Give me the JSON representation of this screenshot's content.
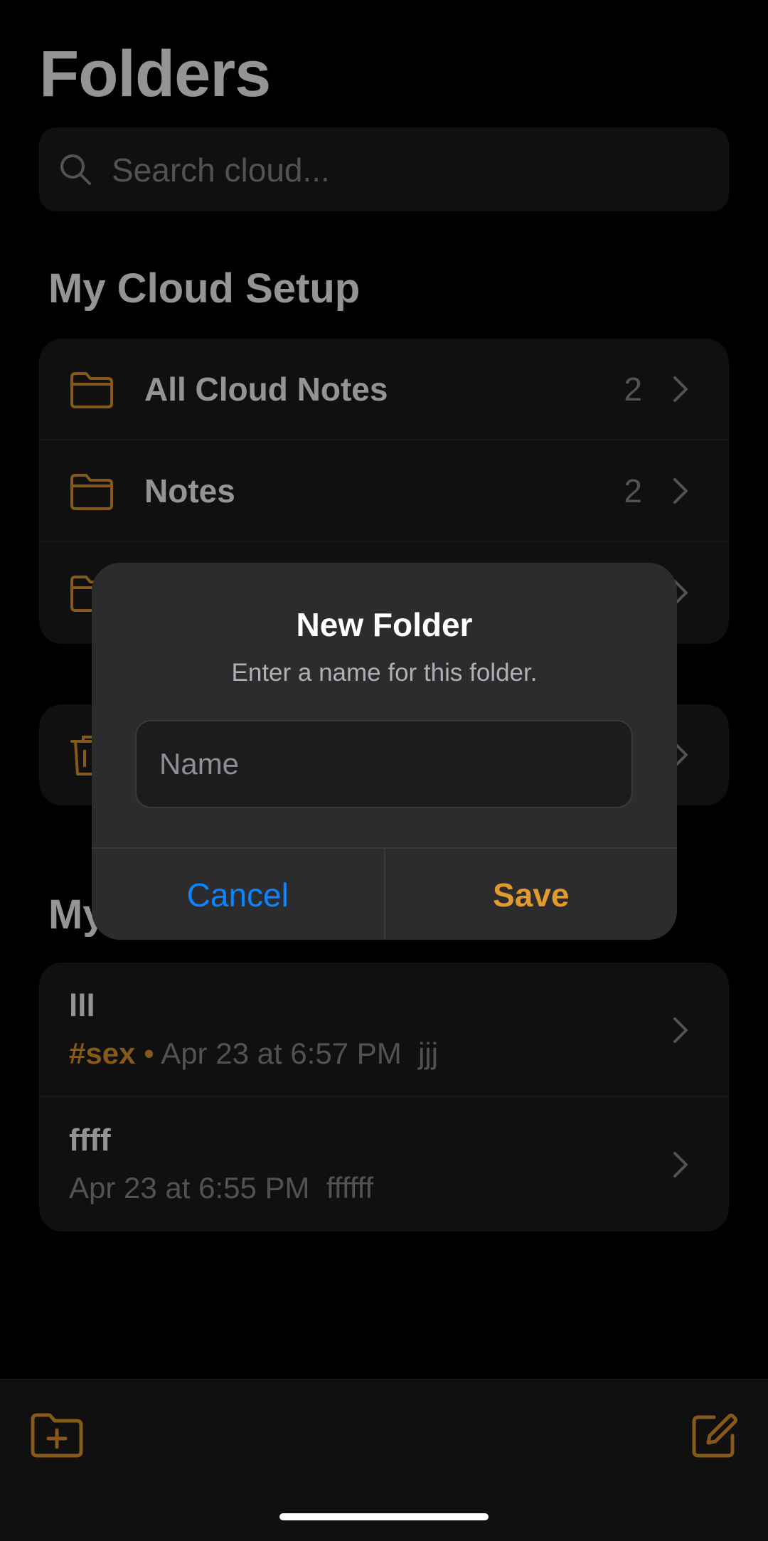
{
  "header": {
    "title": "Folders"
  },
  "search": {
    "placeholder": "Search cloud..."
  },
  "cloud_section": {
    "title": "My Cloud Setup",
    "folders": [
      {
        "label": "All Cloud Notes",
        "count": "2"
      },
      {
        "label": "Notes",
        "count": "2"
      },
      {
        "label": "",
        "count": ""
      }
    ]
  },
  "notes_section": {
    "title": "My",
    "notes": [
      {
        "title": "lll",
        "tag": "#sex",
        "separator": "•",
        "date": "Apr 23 at 6:57 PM",
        "preview": "jjj"
      },
      {
        "title": "ffff",
        "tag": "",
        "separator": "",
        "date": "Apr 23 at 6:55 PM",
        "preview": "ffffff"
      }
    ]
  },
  "dialog": {
    "title": "New Folder",
    "message": "Enter a name for this folder.",
    "input_placeholder": "Name",
    "input_value": "",
    "cancel_label": "Cancel",
    "save_label": "Save"
  },
  "icons": {
    "search": "search-icon",
    "folder": "folder-icon",
    "trash": "trash-icon",
    "chevron": "chevron-right-icon",
    "new_folder": "folder-plus-icon",
    "compose": "compose-icon"
  },
  "colors": {
    "accent": "#e39a2d",
    "link": "#0a84ff",
    "background": "#000000",
    "surface": "#1c1c1e",
    "dialog": "#2c2c2e"
  }
}
